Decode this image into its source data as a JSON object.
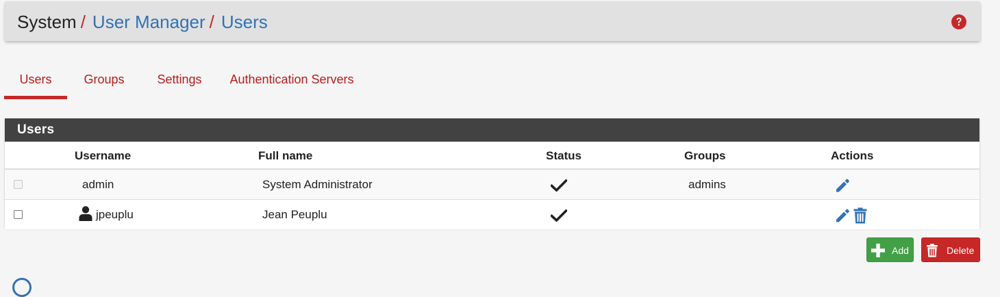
{
  "breadcrumb": {
    "root": "System",
    "separator": "/",
    "links": [
      "User Manager",
      "Users"
    ]
  },
  "help_icon": "question-circle-icon",
  "tabs": [
    {
      "label": "Users",
      "active": true
    },
    {
      "label": "Groups",
      "active": false
    },
    {
      "label": "Settings",
      "active": false
    },
    {
      "label": "Authentication Servers",
      "active": false
    }
  ],
  "panel": {
    "title": "Users",
    "columns": [
      "Username",
      "Full name",
      "Status",
      "Groups",
      "Actions"
    ],
    "rows": [
      {
        "username": "admin",
        "full_name": "System Administrator",
        "status": "enabled",
        "groups": "admins",
        "selectable": false,
        "actions": [
          "edit"
        ]
      },
      {
        "username": "jpeuplu",
        "full_name": "Jean Peuplu",
        "status": "enabled",
        "groups": "",
        "selectable": true,
        "actions": [
          "edit",
          "delete"
        ]
      }
    ]
  },
  "buttons": {
    "add": "Add",
    "delete": "Delete"
  },
  "colors": {
    "accent_red": "#c62828",
    "link_blue": "#3172b5",
    "panel_header": "#424242",
    "add_green": "#43a047"
  }
}
